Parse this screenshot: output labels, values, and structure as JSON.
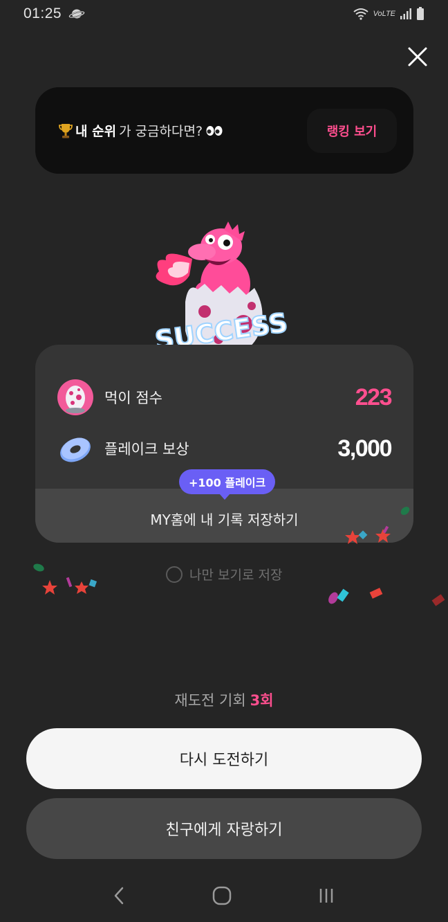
{
  "status_bar": {
    "time": "01:25",
    "volte": "VoLTE"
  },
  "rank_banner": {
    "emphasis": "내 순위",
    "rest": "가 궁금하다면?",
    "button_label": "랭킹 보기"
  },
  "mascot": {
    "caption": "SUCCESS"
  },
  "score_card": {
    "eat_score_label": "먹이 점수",
    "eat_score_value": "223",
    "flake_reward_label": "플레이크 보상",
    "flake_reward_value": "3,000",
    "bonus_tooltip": "+100 플레이크",
    "save_record_label": "MY홈에 내 기록 저장하기"
  },
  "private_save": {
    "label": "나만 보기로 저장"
  },
  "retry_info": {
    "label": "재도전 기회",
    "count": "3회"
  },
  "buttons": {
    "retry": "다시 도전하기",
    "share": "친구에게 자랑하기"
  },
  "colors": {
    "accent_pink": "#ff4f8f",
    "tooltip_purple": "#6a5ff5",
    "background": "#252525"
  }
}
